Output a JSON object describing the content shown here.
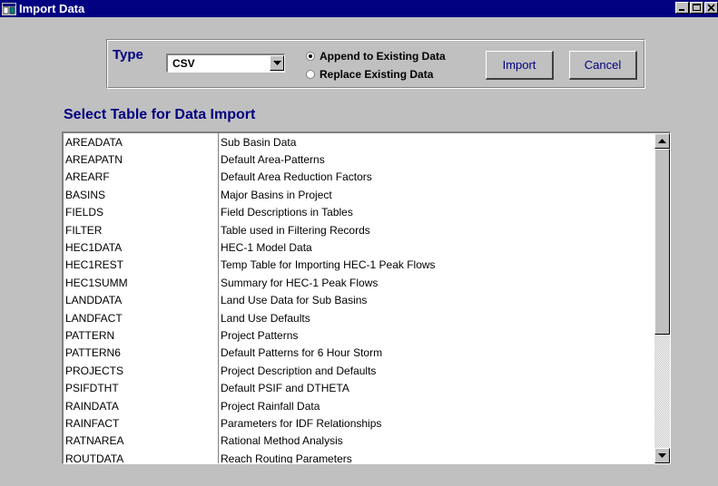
{
  "window": {
    "title": "Import Data",
    "controls": [
      "minimize",
      "maximize",
      "close"
    ]
  },
  "import_options": {
    "type_label": "Type",
    "type_value": "CSV",
    "radio_append": "Append to Existing Data",
    "radio_replace": "Replace Existing Data",
    "selected_mode": "append",
    "import_button": "Import",
    "cancel_button": "Cancel"
  },
  "table_section": {
    "title": "Select Table for Data Import",
    "rows": [
      {
        "name": "AREADATA",
        "desc": "Sub Basin Data"
      },
      {
        "name": "AREAPATN",
        "desc": "Default Area-Patterns"
      },
      {
        "name": "AREARF",
        "desc": "Default Area Reduction Factors"
      },
      {
        "name": "BASINS",
        "desc": "Major Basins in Project"
      },
      {
        "name": "FIELDS",
        "desc": "Field Descriptions in Tables"
      },
      {
        "name": "FILTER",
        "desc": "Table used in Filtering Records"
      },
      {
        "name": "HEC1DATA",
        "desc": "HEC-1 Model Data"
      },
      {
        "name": "HEC1REST",
        "desc": "Temp Table for Importing HEC-1 Peak Flows"
      },
      {
        "name": "HEC1SUMM",
        "desc": "Summary for HEC-1 Peak Flows"
      },
      {
        "name": "LANDDATA",
        "desc": "Land Use Data for Sub Basins"
      },
      {
        "name": "LANDFACT",
        "desc": "Land Use Defaults"
      },
      {
        "name": "PATTERN",
        "desc": "Project Patterns"
      },
      {
        "name": "PATTERN6",
        "desc": "Default Patterns for 6 Hour Storm"
      },
      {
        "name": "PROJECTS",
        "desc": "Project Description and Defaults"
      },
      {
        "name": "PSIFDTHT",
        "desc": "Default PSIF and DTHETA"
      },
      {
        "name": "RAINDATA",
        "desc": "Project Rainfall Data"
      },
      {
        "name": "RAINFACT",
        "desc": "Parameters for IDF Relationships"
      },
      {
        "name": "RATNAREA",
        "desc": "Rational Method Analysis"
      },
      {
        "name": "ROUTDATA",
        "desc": "Reach Routing Parameters"
      }
    ]
  },
  "colors": {
    "titlebar": "#000080",
    "window_bg": "#c0c0c0",
    "accent_text": "#000080"
  }
}
